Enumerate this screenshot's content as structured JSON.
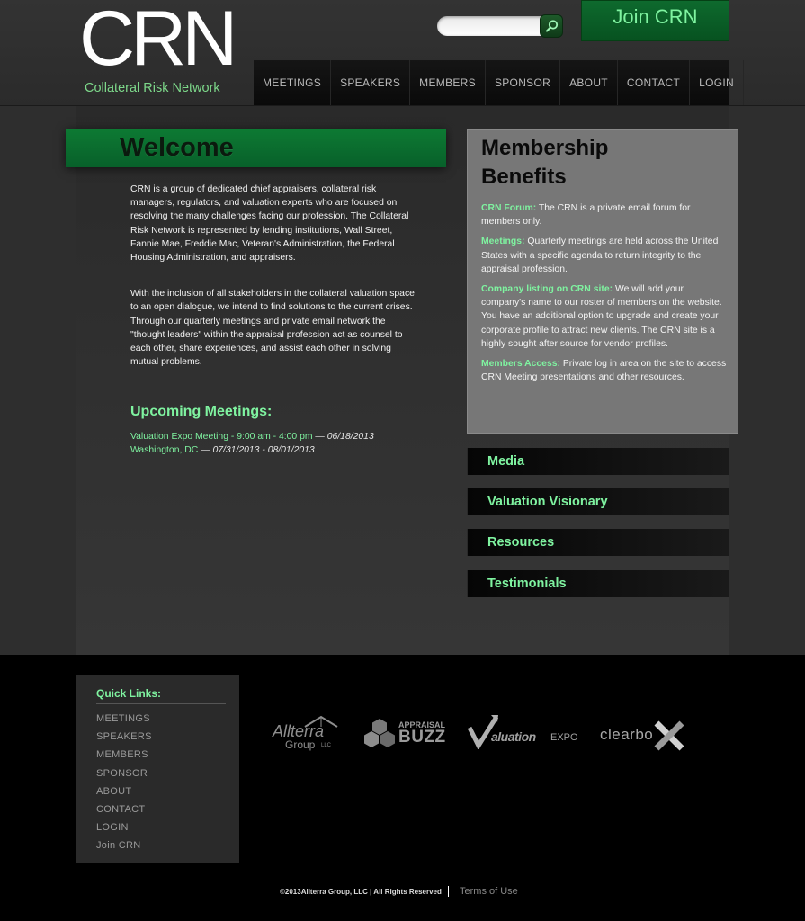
{
  "header": {
    "logo_text": "CRN",
    "logo_subtitle": "Collateral Risk Network",
    "search": {
      "placeholder": "",
      "button_icon": "search-icon"
    },
    "join_label": "Join CRN"
  },
  "nav": {
    "items": [
      {
        "label": "MEETINGS"
      },
      {
        "label": "SPEAKERS"
      },
      {
        "label": "MEMBERS"
      },
      {
        "label": "SPONSOR"
      },
      {
        "label": "ABOUT"
      },
      {
        "label": "CONTACT"
      },
      {
        "label": "LOGIN"
      }
    ]
  },
  "welcome": {
    "title": "Welcome",
    "paragraphs": [
      "CRN is a group of dedicated chief appraisers, collateral risk managers, regulators, and valuation experts who are focused on resolving the many challenges facing our profession. The Collateral Risk Network is represented by lending institutions, Wall Street, Fannie Mae, Freddie Mac, Veteran's Administration, the Federal Housing Administration, and appraisers.",
      "With the inclusion of all stakeholders in the collateral valuation space to an open dialogue, we intend to find solutions to the current crises. Through our quarterly meetings and private email network the \"thought leaders\" within the appraisal profession act as counsel to each other, share experiences, and assist each other in solving mutual problems."
    ]
  },
  "upcoming": {
    "title": "Upcoming Meetings:",
    "meetings": [
      {
        "name": "Valuation Expo Meeting - 9:00 am - 4:00 pm",
        "sep": " — ",
        "date": "06/18/2013"
      },
      {
        "name": "Washington, DC",
        "sep": " — ",
        "date": "07/31/2013 - 08/01/2013"
      }
    ]
  },
  "benefits": {
    "title": "Membership Benefits",
    "items": [
      {
        "key": "CRN Forum:",
        "text": " The CRN is a private email forum for members only."
      },
      {
        "key": "Meetings:",
        "text": " Quarterly meetings are held across the United States with a specific agenda to return integrity to the appraisal profession."
      },
      {
        "key": "Company listing on CRN site:",
        "text": " We will add your company's name to our roster of members on the website.  You have an additional option to upgrade and create your corporate profile to attract new clients. The CRN site is a highly sought after source for vendor profiles."
      },
      {
        "key": "Members Access:",
        "text": " Private log in area on the site to access CRN Meeting presentations and other resources."
      }
    ]
  },
  "side_links": [
    {
      "label": "Media"
    },
    {
      "label": "Valuation Visionary"
    },
    {
      "label": "Resources"
    },
    {
      "label": "Testimonials"
    }
  ],
  "footer": {
    "quick_links_title": "Quick Links:",
    "quick_links": [
      {
        "label": "MEETINGS"
      },
      {
        "label": "SPEAKERS"
      },
      {
        "label": "MEMBERS"
      },
      {
        "label": "SPONSOR"
      },
      {
        "label": "ABOUT"
      },
      {
        "label": "CONTACT"
      },
      {
        "label": "LOGIN"
      },
      {
        "label": "Join CRN"
      }
    ],
    "partners": {
      "allterra": {
        "name": "Allterra",
        "sub": "Group",
        "suffix": "LLC"
      },
      "buzz": {
        "top": "APPRAISAL",
        "name": "BUZZ"
      },
      "vexpo": {
        "name": "aluation",
        "suffix": "EXPO"
      },
      "clearbox": {
        "name": "clearbo"
      }
    },
    "copyright": "©2013Allterra Group, LLC | All Rights Reserved",
    "terms_label": "Terms of Use"
  },
  "colors": {
    "accent": "#7ff3a0",
    "brand_green": "#0d7a33",
    "background": "#2e2e2e"
  }
}
